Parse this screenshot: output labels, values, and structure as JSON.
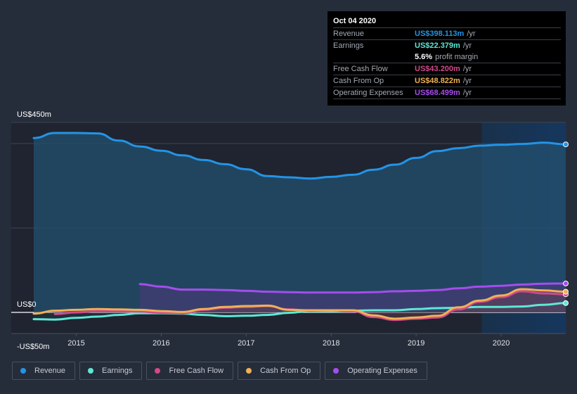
{
  "tooltip": {
    "date": "Oct 04 2020",
    "rows": [
      {
        "label": "Revenue",
        "value": "US$398.113m",
        "unit": "/yr",
        "color": "#2394e6"
      },
      {
        "label": "Earnings",
        "value": "US$22.379m",
        "unit": "/yr",
        "color": "#5ee8d5"
      },
      {
        "label": "",
        "value": "5.6%",
        "unit": "profit margin",
        "color": "#ffffff"
      },
      {
        "label": "Free Cash Flow",
        "value": "US$43.200m",
        "unit": "/yr",
        "color": "#d1498a"
      },
      {
        "label": "Cash From Op",
        "value": "US$48.822m",
        "unit": "/yr",
        "color": "#f0b155"
      },
      {
        "label": "Operating Expenses",
        "value": "US$68.499m",
        "unit": "/yr",
        "color": "#a54ded"
      }
    ]
  },
  "legend": [
    {
      "label": "Revenue",
      "color": "#2394e6"
    },
    {
      "label": "Earnings",
      "color": "#5ee8d5"
    },
    {
      "label": "Free Cash Flow",
      "color": "#d1498a"
    },
    {
      "label": "Cash From Op",
      "color": "#f0b155"
    },
    {
      "label": "Operating Expenses",
      "color": "#a54ded"
    }
  ],
  "chart_data": {
    "type": "line",
    "title": "",
    "xlabel": "",
    "ylabel": "",
    "y_tick_labels": [
      "US$450m",
      "US$0",
      "-US$50m"
    ],
    "ylim": [
      -50,
      450
    ],
    "xlim": [
      2014.5,
      2020.76
    ],
    "x_tick_labels": [
      "2015",
      "2016",
      "2017",
      "2018",
      "2019",
      "2020"
    ],
    "x_ticks": [
      2015,
      2016,
      2017,
      2018,
      2019,
      2020
    ],
    "highlight_start": 2019.77,
    "series": [
      {
        "name": "Revenue",
        "color": "#2394e6",
        "x": [
          2014.5,
          2014.75,
          2015.0,
          2015.25,
          2015.5,
          2015.75,
          2016.0,
          2016.25,
          2016.5,
          2016.75,
          2017.0,
          2017.25,
          2017.5,
          2017.75,
          2018.0,
          2018.25,
          2018.5,
          2018.75,
          2019.0,
          2019.25,
          2019.5,
          2019.75,
          2020.0,
          2020.25,
          2020.5,
          2020.76
        ],
        "y": [
          413,
          425,
          425,
          424,
          407,
          393,
          383,
          372,
          361,
          351,
          339,
          323,
          320,
          317,
          321,
          326,
          338,
          350,
          366,
          382,
          389,
          395,
          397,
          399,
          402,
          398
        ]
      },
      {
        "name": "Earnings",
        "color": "#5ee8d5",
        "x": [
          2014.5,
          2014.75,
          2015.0,
          2015.25,
          2015.5,
          2015.75,
          2016.0,
          2016.25,
          2016.5,
          2016.75,
          2017.0,
          2017.25,
          2017.5,
          2017.75,
          2018.0,
          2018.25,
          2018.5,
          2018.75,
          2019.0,
          2019.25,
          2019.5,
          2019.75,
          2020.0,
          2020.25,
          2020.5,
          2020.76
        ],
        "y": [
          -16,
          -17,
          -13,
          -10,
          -6,
          -2,
          -2,
          -3,
          -6,
          -9,
          -8,
          -6,
          -1,
          3,
          3,
          4,
          5,
          5,
          8,
          10,
          11,
          13,
          13,
          14,
          18,
          22
        ]
      },
      {
        "name": "Free Cash Flow",
        "color": "#d1498a",
        "x": [
          2014.75,
          2015.0,
          2015.25,
          2015.5,
          2015.75,
          2016.0,
          2016.25,
          2016.5,
          2016.75,
          2017.0,
          2017.25,
          2017.5,
          2017.75,
          2018.0,
          2018.25,
          2018.5,
          2018.75,
          2019.0,
          2019.25,
          2019.5,
          2019.75,
          2020.0,
          2020.25,
          2020.5,
          2020.76
        ],
        "y": [
          -4,
          0,
          3,
          3,
          2,
          -1,
          -2,
          6,
          11,
          13,
          15,
          7,
          4,
          5,
          3,
          -11,
          -18,
          -15,
          -12,
          7,
          25,
          36,
          50,
          45,
          43
        ]
      },
      {
        "name": "Cash From Op",
        "color": "#f0b155",
        "x": [
          2014.5,
          2014.75,
          2015.0,
          2015.25,
          2015.5,
          2015.75,
          2016.0,
          2016.25,
          2016.5,
          2016.75,
          2017.0,
          2017.25,
          2017.5,
          2017.75,
          2018.0,
          2018.25,
          2018.5,
          2018.75,
          2019.0,
          2019.25,
          2019.5,
          2019.75,
          2020.0,
          2020.25,
          2020.5,
          2020.76
        ],
        "y": [
          -3,
          4,
          6,
          8,
          7,
          6,
          3,
          1,
          8,
          13,
          15,
          16,
          6,
          5,
          5,
          5,
          -7,
          -15,
          -12,
          -8,
          12,
          28,
          40,
          55,
          52,
          49
        ]
      },
      {
        "name": "Operating Expenses",
        "color": "#a54ded",
        "x": [
          2015.75,
          2016.0,
          2016.25,
          2016.5,
          2016.75,
          2017.0,
          2017.25,
          2017.5,
          2017.75,
          2018.0,
          2018.25,
          2018.5,
          2018.75,
          2019.0,
          2019.25,
          2019.5,
          2019.75,
          2020.0,
          2020.25,
          2020.5,
          2020.76
        ],
        "y": [
          67,
          61,
          54,
          54,
          53,
          51,
          49,
          48,
          47,
          47,
          47,
          48,
          50,
          51,
          53,
          57,
          61,
          63,
          66,
          68,
          68.5
        ]
      }
    ]
  }
}
